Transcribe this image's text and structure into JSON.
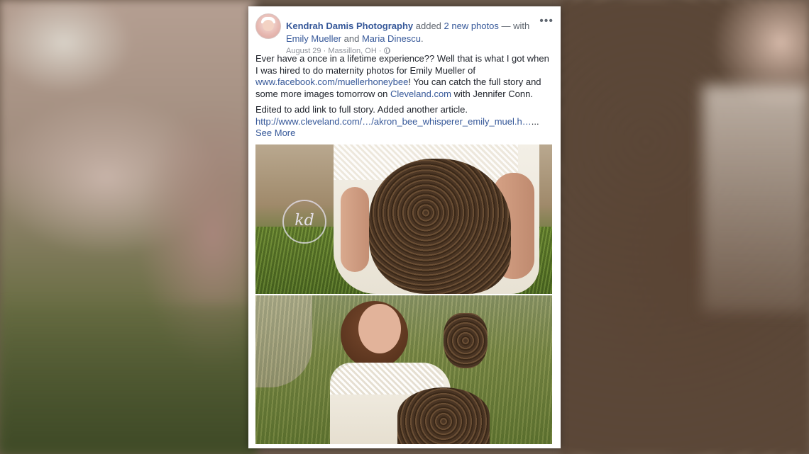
{
  "post": {
    "page_name": "Kendrah Damis Photography",
    "action_text": " added ",
    "photos_link": "2 new photos",
    "with_text": " — with",
    "tagged_1": "Emily Mueller",
    "and_text": " and ",
    "tagged_2": "Maria Dinescu",
    "end_period": ".",
    "date": "August 29",
    "separator": " · ",
    "location": "Massillon, OH",
    "separator2": " · ",
    "more_icon": "more-options-icon",
    "privacy_icon": "globe-icon",
    "text_1_a": "Ever have a once in a lifetime experience?? Well that is what I got when I was hired to do maternity photos for Emily Mueller of ",
    "text_1_link1": "www.facebook.com/muellerhoneybee",
    "text_1_b": "! You can catch the full story and some more images tomorrow on ",
    "text_1_link2": "Cleveland.com",
    "text_1_c": " with Jennifer Conn.",
    "text_2": "Edited to add link to full story. Added another article.",
    "text_2_link": "http://www.cleveland.com/…/akron_bee_whisperer_emily_muel.h…",
    "text_2_ellipsis": "...",
    "see_more": "See More",
    "watermark": "kd"
  },
  "colors": {
    "link": "#365899",
    "text": "#1d2129",
    "meta": "#90949c"
  }
}
